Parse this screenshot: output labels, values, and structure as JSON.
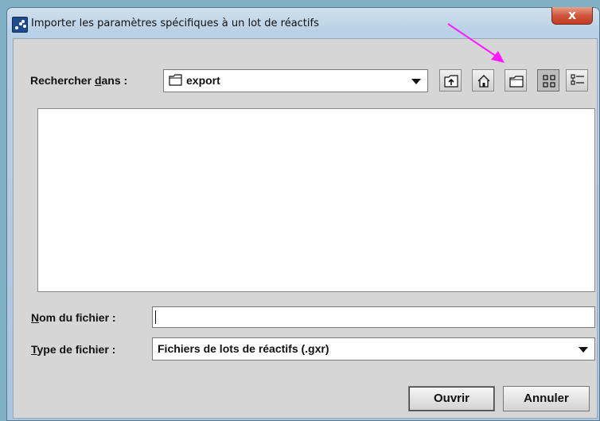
{
  "window": {
    "title": "Importer les paramètres spécifiques à un lot de réactifs",
    "close_glyph": "x",
    "app_icon": "app-logo-icon"
  },
  "toolbar": {
    "look_in_label_pre": "Rechercher ",
    "look_in_label_mnemonic": "d",
    "look_in_label_post": "ans :",
    "current_folder": "export",
    "folder_icon": "folder-icon",
    "buttons": [
      {
        "name": "up-one-level",
        "icon": "up-folder-icon"
      },
      {
        "name": "home",
        "icon": "home-icon"
      },
      {
        "name": "new-folder",
        "icon": "new-folder-icon"
      },
      {
        "name": "list-view",
        "icon": "list-view-icon",
        "pressed": true
      },
      {
        "name": "details-view",
        "icon": "details-view-icon"
      }
    ]
  },
  "form": {
    "filename_label_mnemonic": "N",
    "filename_label_rest": "om du fichier :",
    "filename_value": "",
    "filetype_label_mnemonic": "T",
    "filetype_label_rest": "ype de fichier :",
    "filetype_value": "Fichiers de lots de réactifs (.gxr)"
  },
  "actions": {
    "open_label": "Ouvrir",
    "cancel_label": "Annuler"
  },
  "colors": {
    "annotation_arrow": "#ff1aff",
    "close_button": "#c23b22"
  }
}
